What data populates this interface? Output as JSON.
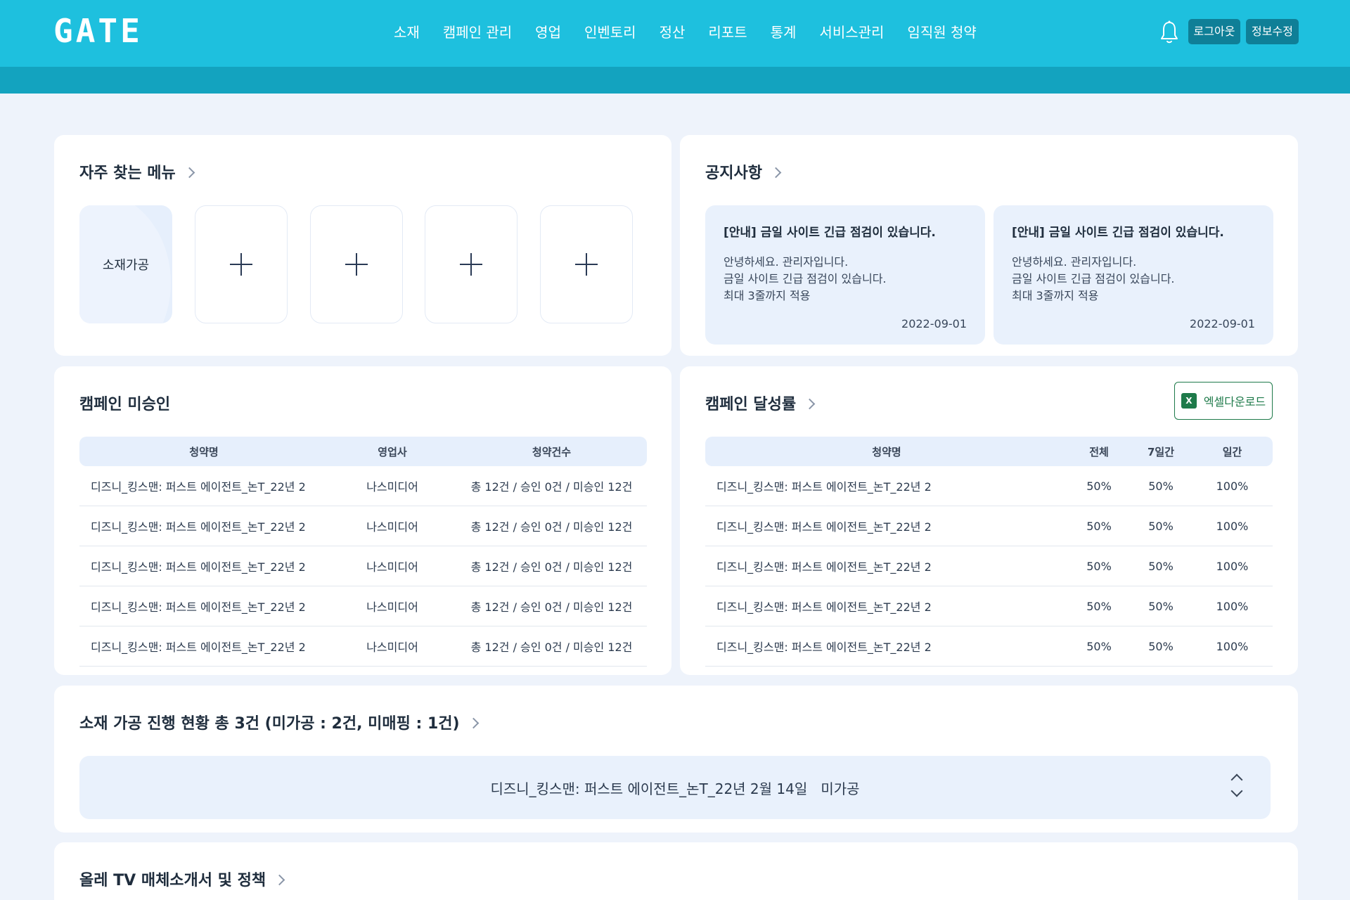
{
  "header": {
    "logo": "GATE",
    "nav": [
      "소재",
      "캠페인 관리",
      "영업",
      "인벤토리",
      "정산",
      "리포트",
      "통계",
      "서비스관리",
      "임직원 청약"
    ],
    "logout_label": "로그아웃",
    "info_label": "정보수정"
  },
  "favorites": {
    "title": "자주 찾는 메뉴",
    "items": [
      "소재가공"
    ]
  },
  "notices": {
    "title": "공지사항",
    "items": [
      {
        "title": "[안내] 금일 사이트 긴급 점검이 있습니다.",
        "lines": [
          "안녕하세요. 관리자입니다.",
          "금일 사이트 긴급 점검이 있습니다.",
          "최대 3줄까지 적용"
        ],
        "date": "2022-09-01"
      },
      {
        "title": "[안내] 금일 사이트 긴급 점검이 있습니다.",
        "lines": [
          "안녕하세요. 관리자입니다.",
          "금일 사이트 긴급 점검이 있습니다.",
          "최대 3줄까지 적용"
        ],
        "date": "2022-09-01"
      }
    ]
  },
  "unapproved": {
    "title": "캠페인 미승인",
    "headers": [
      "청약명",
      "영업사",
      "청약건수"
    ],
    "rows": [
      [
        "디즈니_킹스맨: 퍼스트 에이전트_논T_22년 2",
        "나스미디어",
        "총 12건 / 승인 0건 / 미승인 12건"
      ],
      [
        "디즈니_킹스맨: 퍼스트 에이전트_논T_22년 2",
        "나스미디어",
        "총 12건 / 승인 0건 / 미승인 12건"
      ],
      [
        "디즈니_킹스맨: 퍼스트 에이전트_논T_22년 2",
        "나스미디어",
        "총 12건 / 승인 0건 / 미승인 12건"
      ],
      [
        "디즈니_킹스맨: 퍼스트 에이전트_논T_22년 2",
        "나스미디어",
        "총 12건 / 승인 0건 / 미승인 12건"
      ],
      [
        "디즈니_킹스맨: 퍼스트 에이전트_논T_22년 2",
        "나스미디어",
        "총 12건 / 승인 0건 / 미승인 12건"
      ]
    ]
  },
  "achievement": {
    "title": "캠페인 달성률",
    "excel_label": "엑셀다운로드",
    "headers": [
      "청약명",
      "전체",
      "7일간",
      "일간"
    ],
    "rows": [
      [
        "디즈니_킹스맨: 퍼스트 에이전트_논T_22년 2",
        "50%",
        "50%",
        "100%"
      ],
      [
        "디즈니_킹스맨: 퍼스트 에이전트_논T_22년 2",
        "50%",
        "50%",
        "100%"
      ],
      [
        "디즈니_킹스맨: 퍼스트 에이전트_논T_22년 2",
        "50%",
        "50%",
        "100%"
      ],
      [
        "디즈니_킹스맨: 퍼스트 에이전트_논T_22년 2",
        "50%",
        "50%",
        "100%"
      ],
      [
        "디즈니_킹스맨: 퍼스트 에이전트_논T_22년 2",
        "50%",
        "50%",
        "100%"
      ]
    ]
  },
  "progress": {
    "title": "소재 가공 진행 현황 총 3건 (미가공 : 2건, 미매핑 : 1건)",
    "current": "디즈니_킹스맨: 퍼스트 에이전트_논T_22년 2월 14일   미가공"
  },
  "policy": {
    "title": "올레 TV 매체소개서 및 정책"
  },
  "colors": {
    "header": "#1ec0de",
    "subbar": "#13a3bf",
    "button": "#0f7f97",
    "excel": "#1e7a4a",
    "panel": "#e9f1fc"
  }
}
